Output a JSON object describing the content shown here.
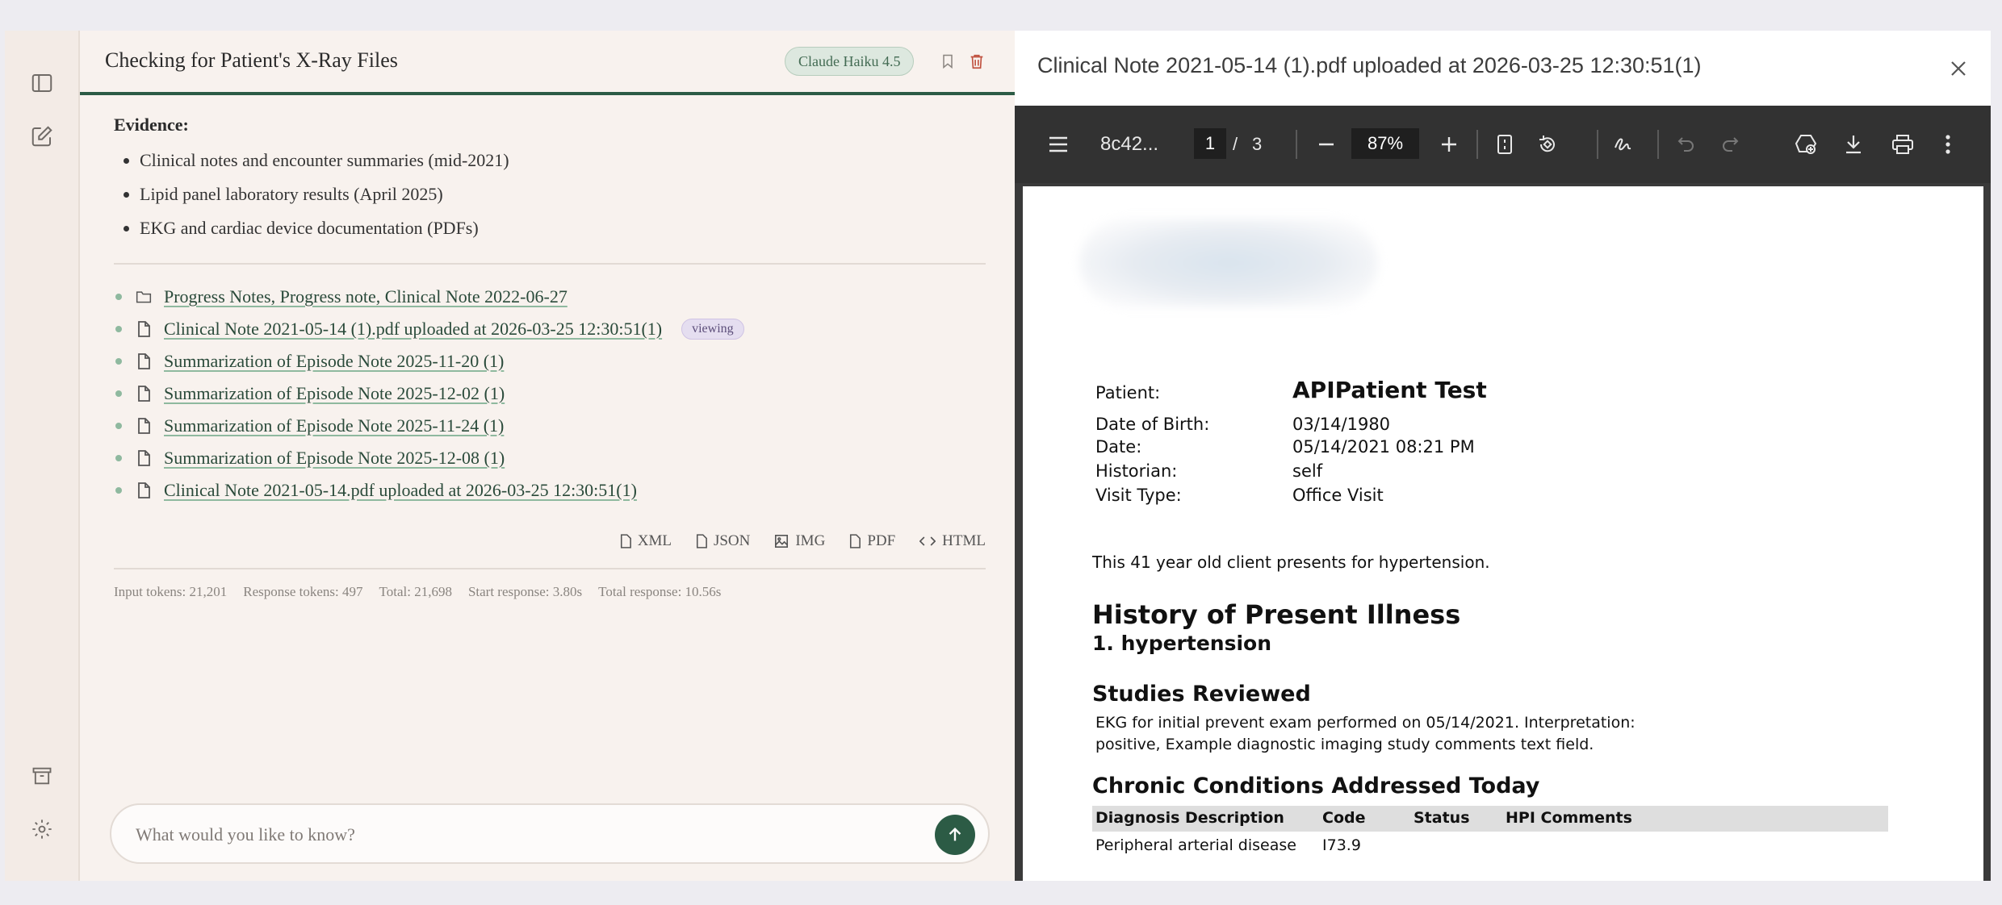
{
  "chat": {
    "title": "Checking for Patient's X-Ray Files",
    "model_badge": "Claude Haiku 4.5",
    "evidence_title": "Evidence:",
    "evidence_items": [
      "Clinical notes and encounter summaries (mid-2021)",
      "Lipid panel laboratory results (April 2025)",
      "EKG and cardiac device documentation (PDFs)"
    ],
    "documents": [
      {
        "label": "Progress Notes, Progress note, Clinical Note 2022-06-27",
        "icon": "folder-icon"
      },
      {
        "label": "Clinical Note 2021-05-14 (1).pdf uploaded at 2026-03-25 12:30:51(1)",
        "icon": "file-icon",
        "badge": "viewing"
      },
      {
        "label": "Summarization of Episode Note 2025-11-20 (1)",
        "icon": "file-icon"
      },
      {
        "label": "Summarization of Episode Note 2025-12-02 (1)",
        "icon": "file-icon"
      },
      {
        "label": "Summarization of Episode Note 2025-11-24 (1)",
        "icon": "file-icon"
      },
      {
        "label": "Summarization of Episode Note 2025-12-08 (1)",
        "icon": "file-icon"
      },
      {
        "label": "Clinical Note 2021-05-14.pdf uploaded at 2026-03-25 12:30:51(1)",
        "icon": "file-icon"
      }
    ],
    "exports": [
      "XML",
      "JSON",
      "IMG",
      "PDF",
      "HTML"
    ],
    "stats": {
      "input_tokens": "Input tokens: 21,201",
      "response_tokens": "Response tokens: 497",
      "total": "Total: 21,698",
      "start_response": "Start response: 3.80s",
      "total_response": "Total response: 10.56s"
    },
    "input_placeholder": "What would you like to know?"
  },
  "viewer": {
    "title": "Clinical Note 2021-05-14 (1).pdf uploaded at 2026-03-25 12:30:51(1)",
    "toolbar": {
      "doc_name": "8c42...",
      "page_current": "1",
      "page_sep": "/",
      "page_total": "3",
      "zoom": "87%"
    },
    "document": {
      "patient_label": "Patient:",
      "patient_name": "APIPatient  Test",
      "dob_label": "Date of Birth:",
      "dob": "03/14/1980",
      "date_label": "Date:",
      "date": "05/14/2021 08:21 PM",
      "historian_label": "Historian:",
      "historian": "self",
      "visit_label": "Visit Type:",
      "visit": "Office Visit",
      "sentence": "This 41 year old client presents for hypertension.",
      "hpi_title": "History of Present Illness",
      "hpi_item": "1.  hypertension",
      "studies_title": "Studies Reviewed",
      "studies_line1": "EKG for initial prevent exam performed on 05/14/2021. Interpretation:",
      "studies_line2": "positive, Example diagnostic imaging study comments text field.",
      "chronic_title": "Chronic Conditions Addressed Today",
      "table_headers": [
        "Diagnosis Description",
        "Code",
        "Status",
        "HPI Comments"
      ],
      "table_row": [
        "Peripheral arterial disease",
        "I73.9",
        "",
        ""
      ]
    }
  },
  "colors": {
    "accent": "#2c5b45",
    "rail_bg": "#f3ebe6",
    "chat_bg": "#f8f2ee",
    "pdf_toolbar": "#323232",
    "delete_icon": "#c0513f"
  }
}
